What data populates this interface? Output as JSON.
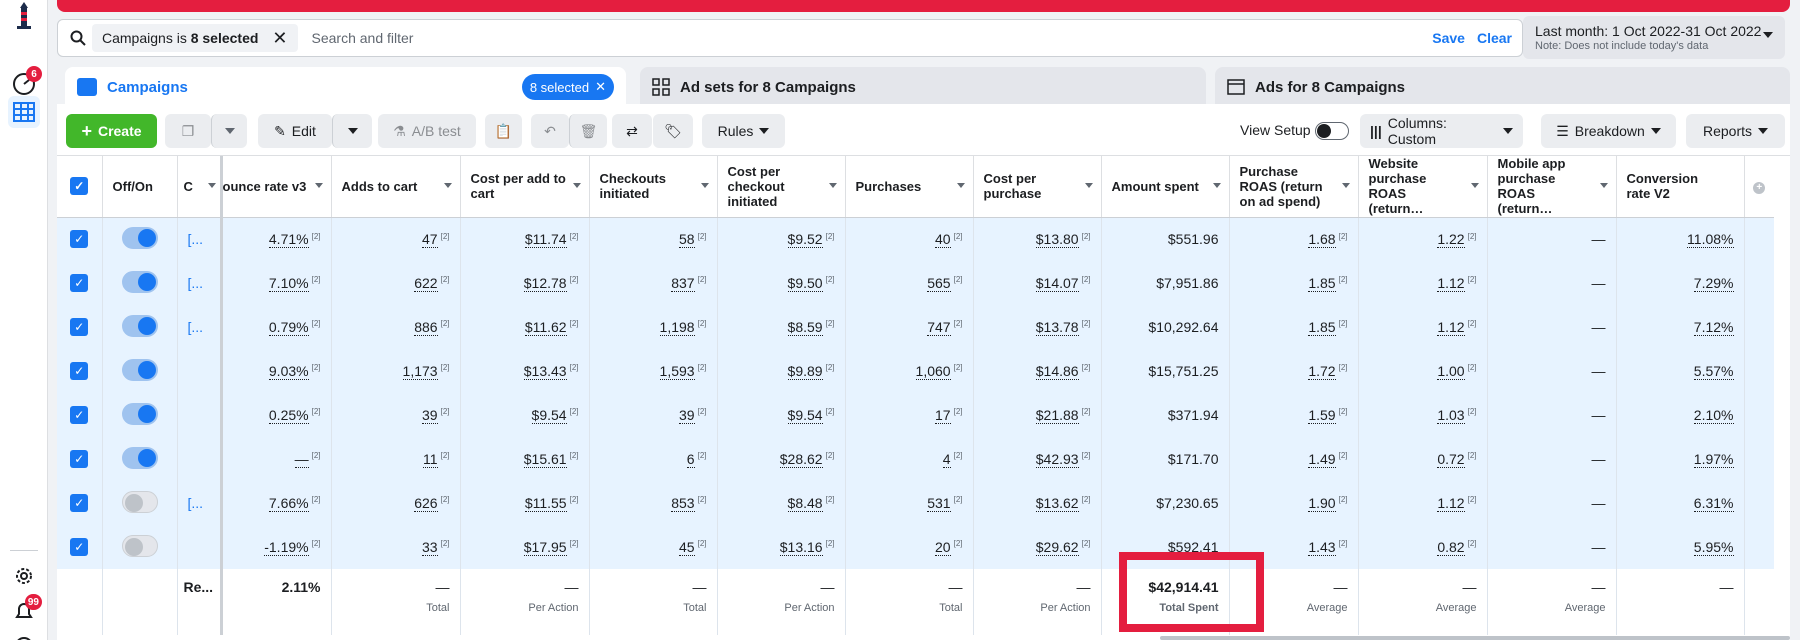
{
  "nav": {
    "notif1": "6",
    "notif2": "99"
  },
  "filter": {
    "chip_prefix": "Campaigns is ",
    "chip_value": "8 selected",
    "search_placeholder": "Search and filter",
    "save": "Save",
    "clear": "Clear"
  },
  "date": {
    "range": "Last month: 1 Oct 2022-31 Oct 2022",
    "note": "Note: Does not include today's data"
  },
  "tabs": {
    "campaigns": "Campaigns",
    "selected": "8 selected",
    "adsets": "Ad sets for 8 Campaigns",
    "ads": "Ads for 8 Campaigns"
  },
  "toolbar": {
    "create": "Create",
    "edit": "Edit",
    "abtest": "A/B test",
    "rules": "Rules",
    "view_setup": "View Setup",
    "columns": "Columns: Custom",
    "breakdown": "Breakdown",
    "reports": "Reports"
  },
  "headers": [
    "Off/On",
    "C",
    "ounce rate v3",
    "Adds to cart",
    "Cost per add to cart",
    "Checkouts initiated",
    "Cost per checkout initiated",
    "Purchases",
    "Cost per purchase",
    "Amount spent",
    "Purchase ROAS (return on ad spend)",
    "Website purchase ROAS (return…",
    "Mobile app purchase ROAS (return…",
    "Conversion rate V2"
  ],
  "rows": [
    {
      "on": true,
      "c": "[...",
      "bounce": "4.71%",
      "adds": "47",
      "cpa": "$11.74",
      "chk": "58",
      "cpc": "$9.52",
      "pur": "40",
      "cpp": "$13.80",
      "spent": "$551.96",
      "roas": "1.68",
      "wroas": "1.22",
      "mroas": "—",
      "conv": "11.08%"
    },
    {
      "on": true,
      "c": "[...",
      "bounce": "7.10%",
      "adds": "622",
      "cpa": "$12.78",
      "chk": "837",
      "cpc": "$9.50",
      "pur": "565",
      "cpp": "$14.07",
      "spent": "$7,951.86",
      "roas": "1.85",
      "wroas": "1.12",
      "mroas": "—",
      "conv": "7.29%"
    },
    {
      "on": true,
      "c": "[...",
      "bounce": "0.79%",
      "adds": "886",
      "cpa": "$11.62",
      "chk": "1,198",
      "cpc": "$8.59",
      "pur": "747",
      "cpp": "$13.78",
      "spent": "$10,292.64",
      "roas": "1.85",
      "wroas": "1.12",
      "mroas": "—",
      "conv": "7.12%"
    },
    {
      "on": true,
      "c": "",
      "bounce": "9.03%",
      "adds": "1,173",
      "cpa": "$13.43",
      "chk": "1,593",
      "cpc": "$9.89",
      "pur": "1,060",
      "cpp": "$14.86",
      "spent": "$15,751.25",
      "roas": "1.72",
      "wroas": "1.00",
      "mroas": "—",
      "conv": "5.57%"
    },
    {
      "on": true,
      "c": "",
      "bounce": "0.25%",
      "adds": "39",
      "cpa": "$9.54",
      "chk": "39",
      "cpc": "$9.54",
      "pur": "17",
      "cpp": "$21.88",
      "spent": "$371.94",
      "roas": "1.59",
      "wroas": "1.03",
      "mroas": "—",
      "conv": "2.10%"
    },
    {
      "on": true,
      "c": "",
      "bounce": "—",
      "adds": "11",
      "cpa": "$15.61",
      "chk": "6",
      "cpc": "$28.62",
      "pur": "4",
      "cpp": "$42.93",
      "spent": "$171.70",
      "roas": "1.49",
      "wroas": "0.72",
      "mroas": "—",
      "conv": "1.97%"
    },
    {
      "on": false,
      "c": "[...",
      "bounce": "7.66%",
      "adds": "626",
      "cpa": "$11.55",
      "chk": "853",
      "cpc": "$8.48",
      "pur": "531",
      "cpp": "$13.62",
      "spent": "$7,230.65",
      "roas": "1.90",
      "wroas": "1.12",
      "mroas": "—",
      "conv": "6.31%"
    },
    {
      "on": false,
      "c": "",
      "bounce": "-1.19%",
      "adds": "33",
      "cpa": "$17.95",
      "chk": "45",
      "cpc": "$13.16",
      "pur": "20",
      "cpp": "$29.62",
      "spent": "$592.41",
      "roas": "1.43",
      "wroas": "0.82",
      "mroas": "—",
      "conv": "5.95%"
    }
  ],
  "totals": {
    "c": "Re...",
    "bounce": "2.11%",
    "dash": "—",
    "spent": "$42,914.41",
    "total": "Total",
    "per_action": "Per Action",
    "total_spent": "Total Spent",
    "average": "Average"
  }
}
